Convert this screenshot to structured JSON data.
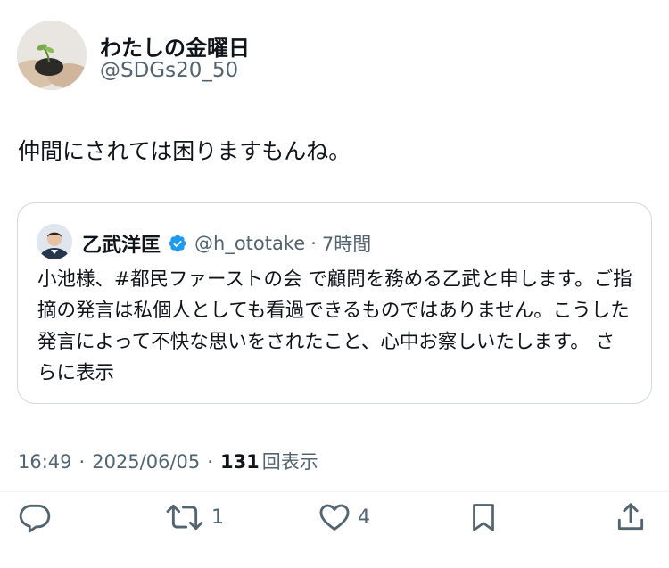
{
  "author": {
    "name": "わたしの金曜日",
    "handle": "@SDGs20_50",
    "avatar_icon": "hands-holding-seedling-avatar"
  },
  "tweet": {
    "text": "仲間にされては困りますもんね。"
  },
  "quote": {
    "name": "乙武洋匡",
    "handle": "@h_ototake",
    "dot": "·",
    "time": "7時間",
    "verified_icon": "verified-badge-icon",
    "body": "小池様、#都民ファーストの会 で顧問を務める乙武と申します。ご指摘の発言は私個人としても看過できるものではありません。こうした発言によって不快な思いをされたこと、心中お察しいたします。",
    "show_more": "さらに表示"
  },
  "meta": {
    "time": "16:49",
    "sep1": "·",
    "date": "2025/06/05",
    "sep2": "·",
    "views_count": "131",
    "views_label": "回表示"
  },
  "actions": {
    "reply": {
      "icon": "reply-icon",
      "count": ""
    },
    "repost": {
      "icon": "repost-icon",
      "count": "1"
    },
    "like": {
      "icon": "heart-icon",
      "count": "4"
    },
    "bookmark": {
      "icon": "bookmark-icon"
    },
    "share": {
      "icon": "share-icon"
    }
  },
  "colors": {
    "text_primary": "#0f1419",
    "text_secondary": "#536471",
    "verified_blue": "#1d9bf0",
    "border": "#cfd9de"
  }
}
